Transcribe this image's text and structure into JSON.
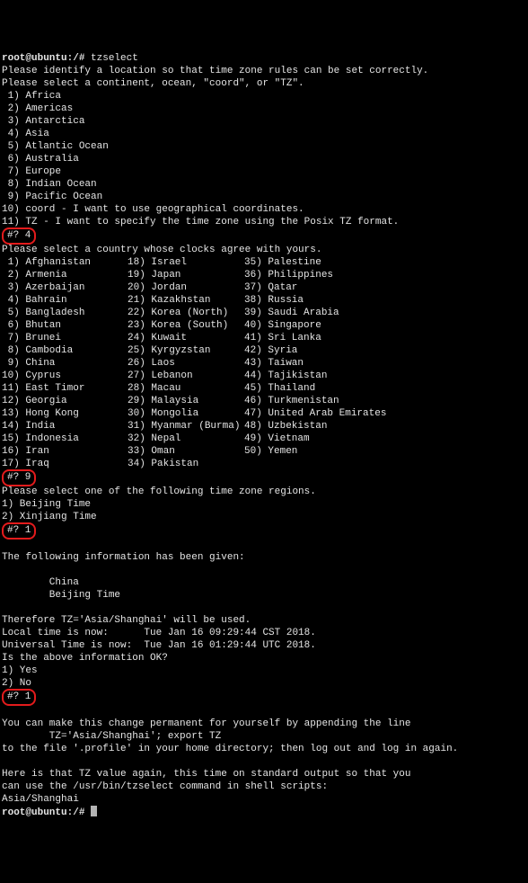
{
  "prompt1_line1": "root@ubuntu:/# ",
  "prompt1_cmd": "tzselect",
  "intro": [
    "Please identify a location so that time zone rules can be set correctly.",
    "Please select a continent, ocean, \"coord\", or \"TZ\"."
  ],
  "continents": [
    " 1) Africa",
    " 2) Americas",
    " 3) Antarctica",
    " 4) Asia",
    " 5) Atlantic Ocean",
    " 6) Australia",
    " 7) Europe",
    " 8) Indian Ocean",
    " 9) Pacific Ocean",
    "10) coord - I want to use geographical coordinates.",
    "11) TZ - I want to specify the time zone using the Posix TZ format."
  ],
  "ans1": "#? 4",
  "country_prompt": "Please select a country whose clocks agree with yours.",
  "countries": [
    {
      "a": " 1) Afghanistan",
      "b": "18) Israel",
      "c": "35) Palestine"
    },
    {
      "a": " 2) Armenia",
      "b": "19) Japan",
      "c": "36) Philippines"
    },
    {
      "a": " 3) Azerbaijan",
      "b": "20) Jordan",
      "c": "37) Qatar"
    },
    {
      "a": " 4) Bahrain",
      "b": "21) Kazakhstan",
      "c": "38) Russia"
    },
    {
      "a": " 5) Bangladesh",
      "b": "22) Korea (North)",
      "c": "39) Saudi Arabia"
    },
    {
      "a": " 6) Bhutan",
      "b": "23) Korea (South)",
      "c": "40) Singapore"
    },
    {
      "a": " 7) Brunei",
      "b": "24) Kuwait",
      "c": "41) Sri Lanka"
    },
    {
      "a": " 8) Cambodia",
      "b": "25) Kyrgyzstan",
      "c": "42) Syria"
    },
    {
      "a": " 9) China",
      "b": "26) Laos",
      "c": "43) Taiwan"
    },
    {
      "a": "10) Cyprus",
      "b": "27) Lebanon",
      "c": "44) Tajikistan"
    },
    {
      "a": "11) East Timor",
      "b": "28) Macau",
      "c": "45) Thailand"
    },
    {
      "a": "12) Georgia",
      "b": "29) Malaysia",
      "c": "46) Turkmenistan"
    },
    {
      "a": "13) Hong Kong",
      "b": "30) Mongolia",
      "c": "47) United Arab Emirates"
    },
    {
      "a": "14) India",
      "b": "31) Myanmar (Burma)",
      "c": "48) Uzbekistan"
    },
    {
      "a": "15) Indonesia",
      "b": "32) Nepal",
      "c": "49) Vietnam"
    },
    {
      "a": "16) Iran",
      "b": "33) Oman",
      "c": "50) Yemen"
    },
    {
      "a": "17) Iraq",
      "b": "34) Pakistan",
      "c": ""
    }
  ],
  "ans2": "#? 9",
  "region_prompt": "Please select one of the following time zone regions.",
  "regions": [
    "1) Beijing Time",
    "2) Xinjiang Time"
  ],
  "ans3": "#? 1",
  "info_head": "The following information has been given:",
  "info_body": [
    "        China",
    "        Beijing Time"
  ],
  "therefore": "Therefore TZ='Asia/Shanghai' will be used.",
  "local_time": "Local time is now:      Tue Jan 16 09:29:44 CST 2018.",
  "utc_time": "Universal Time is now:  Tue Jan 16 01:29:44 UTC 2018.",
  "confirm_q": "Is the above information OK?",
  "yesno": [
    "1) Yes",
    "2) No"
  ],
  "ans4": "#? 1",
  "permanent1": "You can make this change permanent for yourself by appending the line",
  "permanent2": "        TZ='Asia/Shanghai'; export TZ",
  "permanent3": "to the file '.profile' in your home directory; then log out and log in again.",
  "tail1": "Here is that TZ value again, this time on standard output so that you",
  "tail2": "can use the /usr/bin/tzselect command in shell scripts:",
  "tzout": "Asia/Shanghai",
  "prompt2": "root@ubuntu:/# "
}
